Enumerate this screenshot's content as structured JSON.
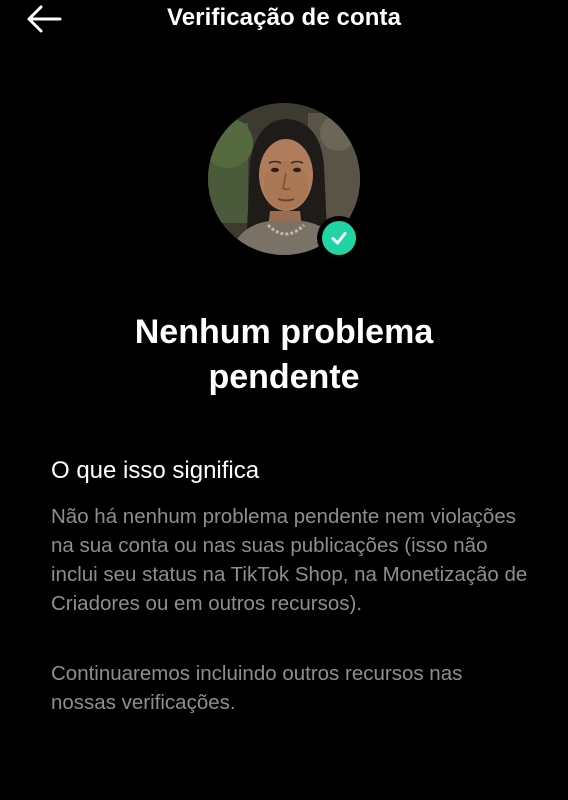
{
  "header": {
    "title": "Verificação de conta",
    "back_icon": "arrow-left-icon"
  },
  "profile": {
    "avatar": "profile-photo",
    "badge_icon": "check-icon",
    "badge_color": "#20d5a3"
  },
  "status": {
    "title_line1": "Nenhum problema",
    "title_line2": "pendente"
  },
  "info": {
    "heading": "O que isso significa",
    "paragraph1": "Não há nenhum problema pendente nem violações na sua conta ou nas suas publicações (isso não inclui seu status na TikTok Shop, na Monetização de Criadores ou em outros recursos).",
    "paragraph2": "Continuaremos incluindo outros recursos nas nossas verificações."
  }
}
